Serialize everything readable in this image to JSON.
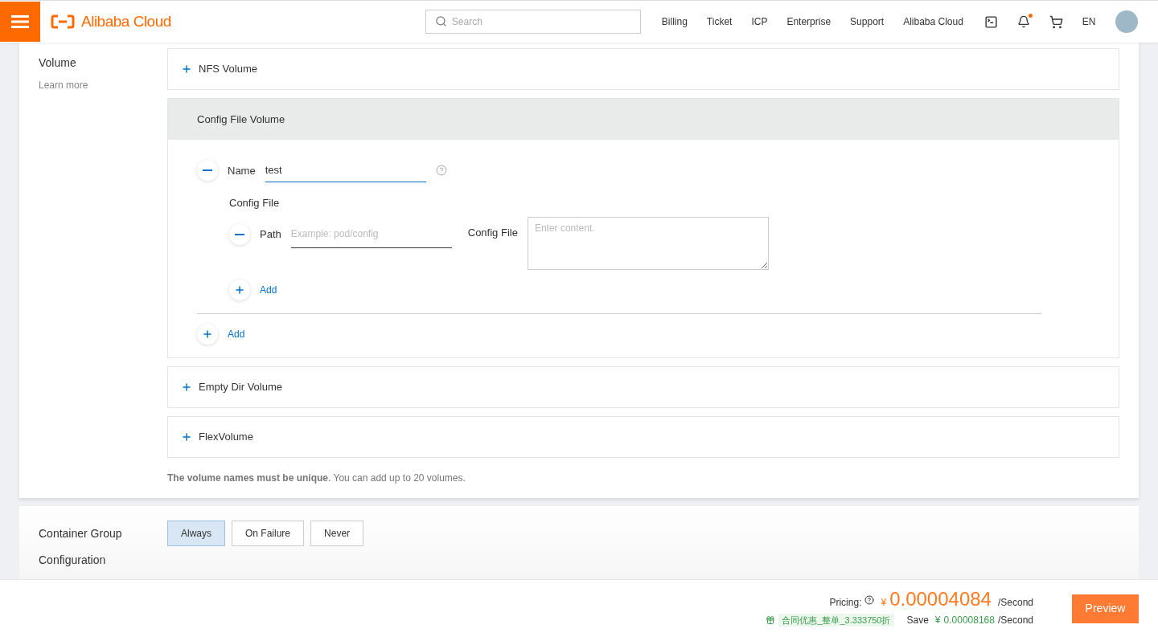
{
  "header": {
    "logo": "Alibaba Cloud",
    "search": {
      "placeholder": "Search"
    },
    "nav": [
      "Billing",
      "Ticket",
      "ICP",
      "Enterprise",
      "Support",
      "Alibaba Cloud"
    ],
    "notifications": {
      "unread": true
    },
    "language": "EN"
  },
  "volume_section": {
    "title": "Volume",
    "link": "Learn more",
    "panels": [
      {
        "title": "NFS Volume",
        "expanded": false
      },
      {
        "title": "Config File Volume",
        "expanded": true,
        "entries": [
          {
            "name_label": "Name",
            "name_value": "test",
            "config_title": "Config File",
            "files": [
              {
                "path_label": "Path",
                "path_placeholder": "Example: pod/config",
                "content_label": "Config File",
                "content_placeholder": "Enter content."
              }
            ],
            "add_file": "Add"
          }
        ],
        "add_entry": "Add"
      },
      {
        "title": "Empty Dir Volume",
        "expanded": false
      },
      {
        "title": "FlexVolume",
        "expanded": false
      }
    ],
    "note": "**The volume names must be unique**. You can add up to 20 volumes."
  },
  "restart_section": {
    "title": "Container Group Configuration",
    "options": [
      {
        "label": "Always",
        "selected": true
      },
      {
        "label": "On Failure",
        "selected": false
      },
      {
        "label": "Never",
        "selected": false
      }
    ]
  },
  "footer": {
    "pricing_label": "Pricing:",
    "currency": "¥",
    "price": "0.00004084",
    "unit": "/Second",
    "discount": "合同优惠_整单_3.333750折",
    "save_label": "Save",
    "save_currency": "¥",
    "save_amount": "0.00008168",
    "save_unit": "/Second",
    "preview": "Preview"
  }
}
